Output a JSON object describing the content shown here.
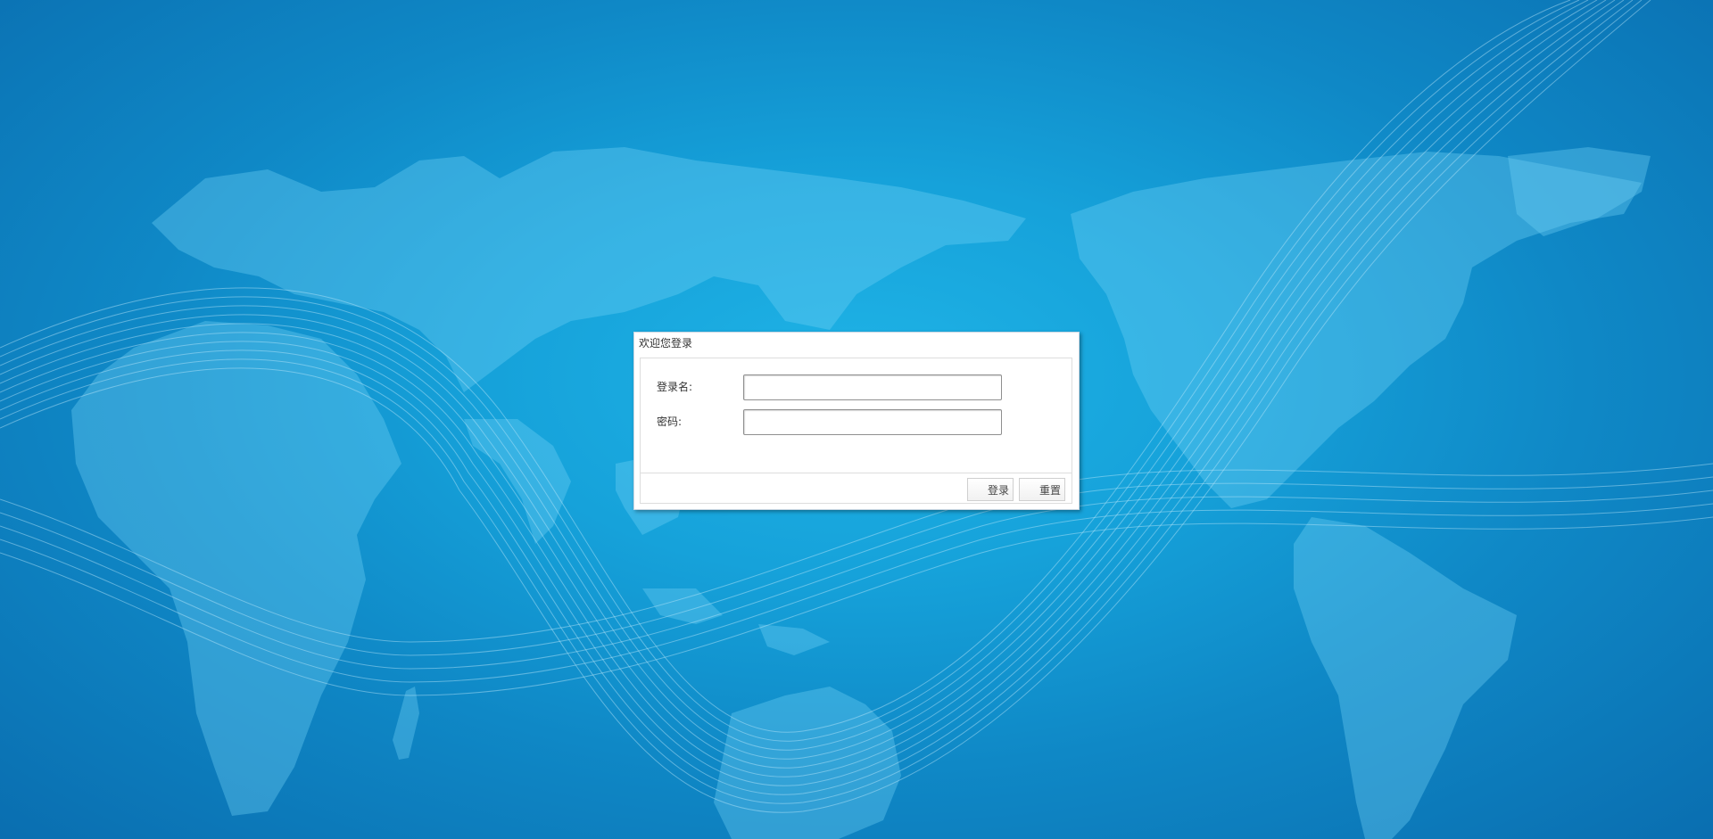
{
  "dialog": {
    "title": "欢迎您登录"
  },
  "form": {
    "username_label": "登录名:",
    "username_value": "",
    "password_label": "密码:",
    "password_value": ""
  },
  "buttons": {
    "login_label": "登录",
    "reset_label": "重置"
  },
  "colors": {
    "background_center": "#1fb3e6",
    "background_edge": "#0a6eb0",
    "continent": "#5cc4ec"
  }
}
